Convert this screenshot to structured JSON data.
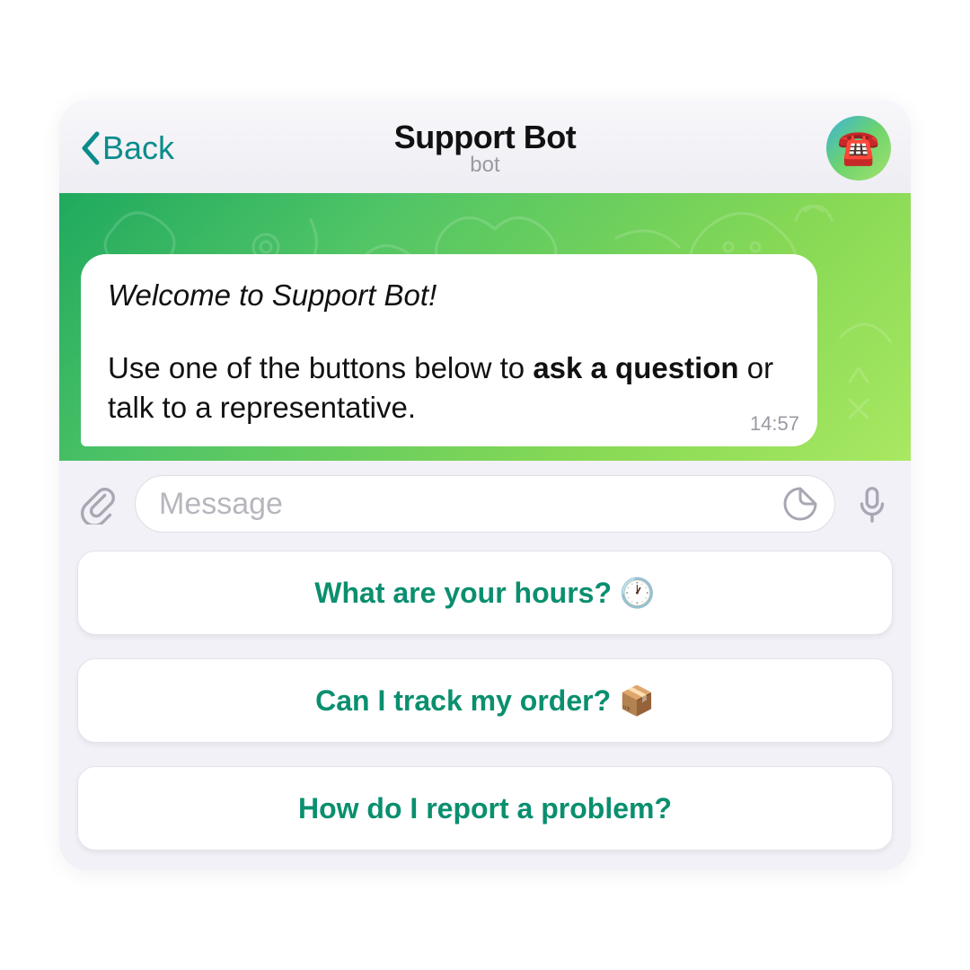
{
  "header": {
    "back_label": "Back",
    "title": "Support Bot",
    "subtitle": "bot",
    "avatar_emoji": "☎️"
  },
  "message": {
    "welcome": "Welcome to Support Bot!",
    "body_pre": "Use one of the buttons below to ",
    "body_bold": "ask a question",
    "body_post": " or talk to a representative.",
    "time": "14:57"
  },
  "input": {
    "placeholder": "Message"
  },
  "reply_buttons": [
    "What are your hours? 🕐",
    "Can I track my order? 📦",
    "How do I report a problem?"
  ]
}
